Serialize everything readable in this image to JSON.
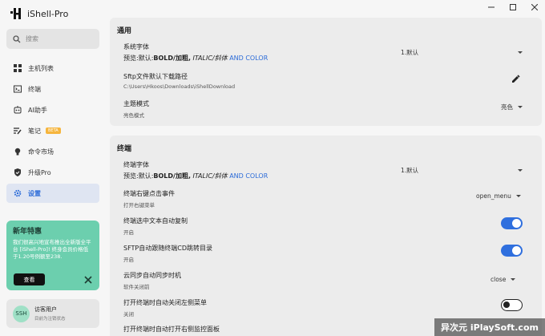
{
  "app": {
    "title": "iShell-Pro"
  },
  "search": {
    "placeholder": "搜索"
  },
  "nav": {
    "items": [
      {
        "label": "主机列表",
        "icon": "grid-icon"
      },
      {
        "label": "终端",
        "icon": "terminal-icon"
      },
      {
        "label": "AI助手",
        "icon": "ai-icon"
      },
      {
        "label": "笔记",
        "icon": "notes-icon",
        "badge": "BETA"
      },
      {
        "label": "命令市场",
        "icon": "bulb-icon"
      },
      {
        "label": "升级Pro",
        "icon": "shield-icon"
      },
      {
        "label": "设置",
        "icon": "gear-icon",
        "active": true
      }
    ]
  },
  "promo": {
    "title": "新年特惠",
    "text": "我们很高兴地宣布推出全新版全平台 [iShell-Pro]! 终身会员价格低于1.20号例额至238.",
    "button": "查看"
  },
  "user": {
    "avatar": "SSH",
    "name": "访客用户",
    "status": "目前为注销状态"
  },
  "general": {
    "title": "通用",
    "font": {
      "title": "系统字体",
      "preview_prefix": "预览:默认:",
      "preview_bold": "BOLD/加粗,",
      "preview_italic": "ITALIC/斜体",
      "preview_color": "AND COLOR",
      "value": "1.默认"
    },
    "download": {
      "title": "Sftp文件默认下载路径",
      "path": "C:\\Users\\Hkoos\\Downloads\\iShellDownload"
    },
    "theme": {
      "title": "主题模式",
      "sub": "亮色模式",
      "value": "亮色"
    }
  },
  "terminal": {
    "title": "终端",
    "font": {
      "title": "终端字体",
      "preview_prefix": "预览:默认:",
      "preview_bold": "BOLD/加粗,",
      "preview_italic": "ITALIC/斜体",
      "preview_color": "AND COLOR",
      "value": "1.默认"
    },
    "right_click": {
      "title": "终端右键点击事件",
      "sub": "打开右键菜单",
      "value": "open_menu"
    },
    "auto_copy": {
      "title": "终端选中文本自动复制",
      "sub": "开启",
      "on": true
    },
    "sftp_follow": {
      "title": "SFTP自动跟随终端CD跳转目录",
      "sub": "开启",
      "on": true
    },
    "cloud_sync": {
      "title": "云同步自动同步时机",
      "sub": "软件关闭前",
      "value": "close"
    },
    "auto_close_left": {
      "title": "打开终端时自动关闭左侧菜单",
      "sub": "关闭",
      "on": false
    },
    "auto_open_right": {
      "title": "打开终端时自动打开右侧监控面板"
    }
  },
  "watermark": "异次元 iPlaySoft.com",
  "colors": {
    "accent": "#2b6bd8",
    "promo": "#6ccfae",
    "toggle_on": "#2f6fde"
  }
}
